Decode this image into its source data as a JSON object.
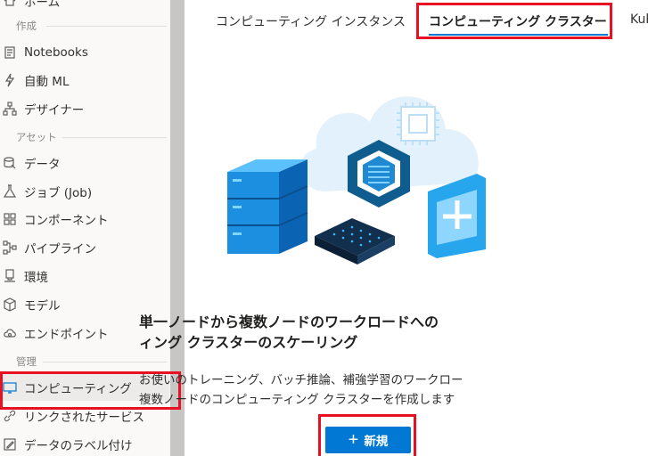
{
  "sidebar": {
    "top_partial": "ホーム",
    "sections": {
      "author": "作成",
      "assets": "アセット",
      "manage": "管理"
    },
    "items": [
      {
        "label": "Notebooks",
        "icon": "notebook-icon"
      },
      {
        "label": "自動 ML",
        "icon": "automl-icon"
      },
      {
        "label": "デザイナー",
        "icon": "designer-icon"
      },
      {
        "label": "データ",
        "icon": "data-icon"
      },
      {
        "label": "ジョブ (Job)",
        "icon": "flask-icon"
      },
      {
        "label": "コンポーネント",
        "icon": "components-icon"
      },
      {
        "label": "パイプライン",
        "icon": "pipeline-icon"
      },
      {
        "label": "環境",
        "icon": "environment-icon"
      },
      {
        "label": "モデル",
        "icon": "model-cube-icon"
      },
      {
        "label": "エンドポイント",
        "icon": "endpoint-cloud-icon"
      },
      {
        "label": "コンピューティング",
        "icon": "compute-monitor-icon"
      },
      {
        "label": "リンクされたサービス",
        "icon": "link-icon"
      },
      {
        "label": "データのラベル付け",
        "icon": "label-edit-icon"
      }
    ]
  },
  "tabs": [
    {
      "label": "コンピューティング インスタンス"
    },
    {
      "label": "コンピューティング クラスター"
    },
    {
      "label": "Kub"
    }
  ],
  "hero": {
    "heading_line1": "単一ノードから複数ノードのワークロードへの",
    "heading_line2": "ィング クラスターのスケーリング",
    "desc_line1": "お使いのトレーニング、バッチ推論、補強学習のワークロー",
    "desc_line2": "複数ノードのコンピューティング クラスターを作成します"
  },
  "actions": {
    "new_label": "新規",
    "new_icon": "plus-icon"
  },
  "colors": {
    "accent": "#0078d4",
    "highlight": "#e81123"
  }
}
